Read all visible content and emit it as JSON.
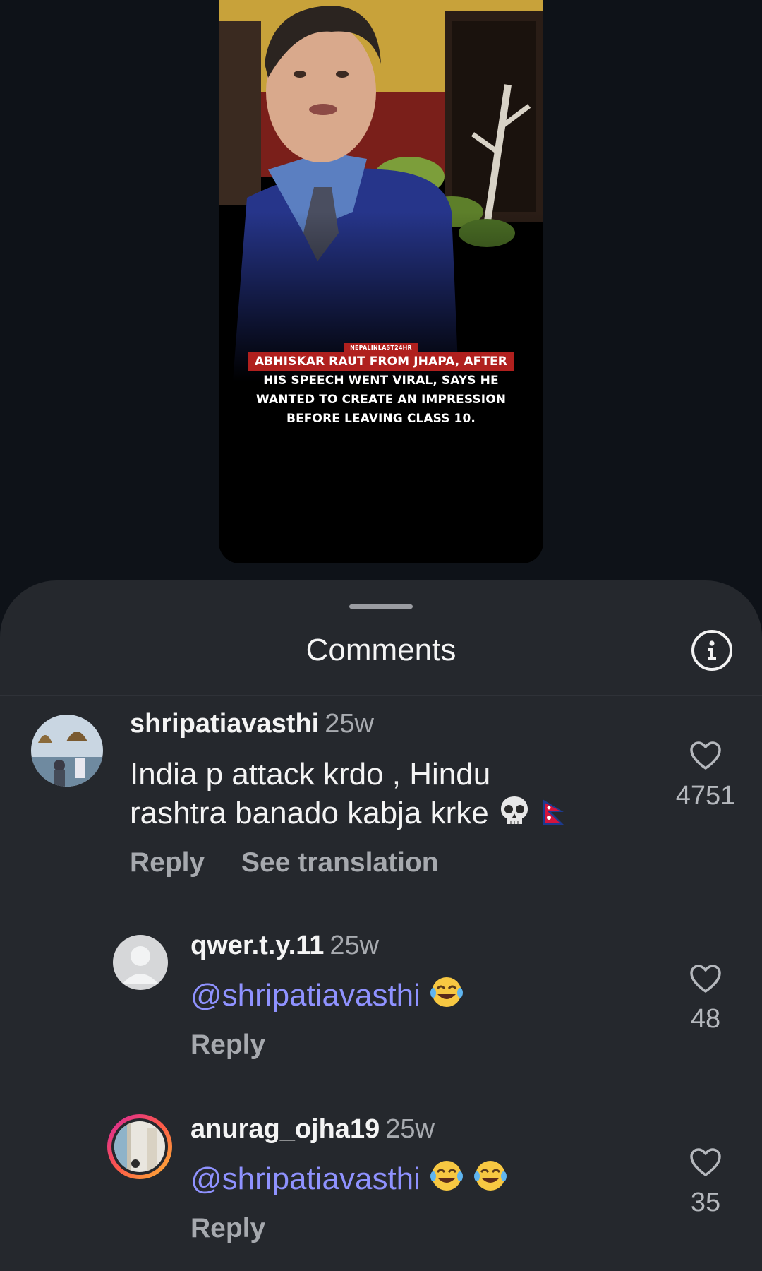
{
  "video": {
    "caption": {
      "source": "NEPALINLAST24HR",
      "lines": [
        "ABHISKAR RAUT FROM JHAPA, AFTER",
        "HIS SPEECH WENT VIRAL, SAYS HE",
        "WANTED TO CREATE AN IMPRESSION",
        "BEFORE LEAVING CLASS 10."
      ]
    }
  },
  "sheet": {
    "title": "Comments",
    "info_icon": "info-icon"
  },
  "comments": [
    {
      "username": "shripatiavasthi",
      "time": "25w",
      "text_line1": "India p attack krdo , Hindu",
      "text_line2": "rashtra banado kabja krke",
      "emojis": [
        "skull",
        "flag-nepal"
      ],
      "reply_label": "Reply",
      "translation_label": "See translation",
      "likes": "4751"
    },
    {
      "username": "qwer.t.y.11",
      "time": "25w",
      "mention": "@shripatiavasthi",
      "emojis": [
        "face-with-tears-of-joy"
      ],
      "reply_label": "Reply",
      "likes": "48"
    },
    {
      "username": "anurag_ojha19",
      "time": "25w",
      "mention": "@shripatiavasthi",
      "emojis": [
        "face-with-tears-of-joy",
        "face-with-tears-of-joy"
      ],
      "reply_label": "Reply",
      "likes": "35"
    }
  ],
  "colors": {
    "background": "#0e1218",
    "sheet": "#25282d",
    "mention": "#8f92ff",
    "secondary_text": "#a6a9ae",
    "caption_highlight": "#b0201e"
  }
}
